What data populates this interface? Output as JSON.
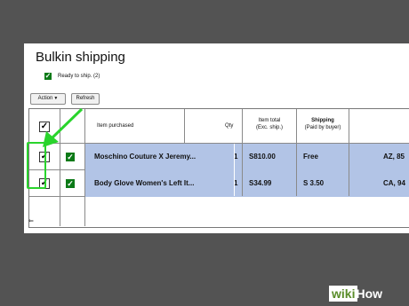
{
  "page": {
    "title": "Bulkin shipping"
  },
  "ready_label": "Ready to ship. (2)",
  "toolbar": {
    "action_label": "Action",
    "refresh_label": "Refresh"
  },
  "table": {
    "headers": {
      "item": "Item purchased",
      "qty": "Qty",
      "item_total_line1": "Item total",
      "item_total_line2": "(Exc. ship.)",
      "shipping_line1": "Shipping",
      "shipping_line2": "(Paid by buyer)"
    },
    "rows": [
      {
        "title": "Moschino Couture X Jeremy...",
        "qty": "1",
        "total": "S810.00",
        "shipping": "Free",
        "location": "AZ, 85"
      },
      {
        "title": "Body Glove Women's Left It...",
        "qty": "1",
        "total": "S34.99",
        "shipping": "S 3.50",
        "location": "CA, 94"
      }
    ]
  },
  "colors": {
    "highlight": "#29d42c",
    "row_bg": "#b2c4e6",
    "check_green": "#0c7a17"
  },
  "watermark": {
    "prefix": "wiki",
    "suffix": "How"
  }
}
